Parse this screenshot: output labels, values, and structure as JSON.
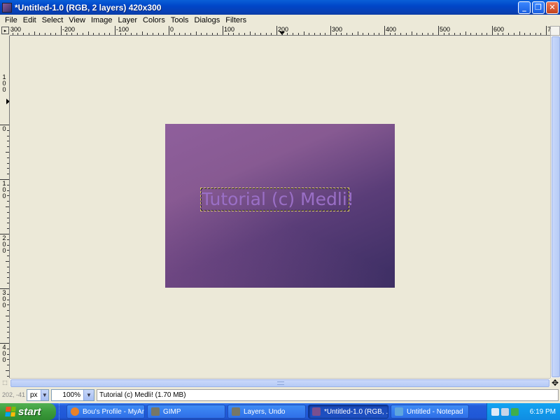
{
  "window": {
    "title": "*Untitled-1.0 (RGB, 2 layers) 420x300",
    "minimize": "_",
    "maximize": "❐",
    "close": "✕"
  },
  "menu": [
    "File",
    "Edit",
    "Select",
    "View",
    "Image",
    "Layer",
    "Colors",
    "Tools",
    "Dialogs",
    "Filters"
  ],
  "hruler_labels": [
    "-300",
    "-200",
    "-100",
    "0",
    "100",
    "200",
    "300",
    "400",
    "500",
    "600",
    "700",
    "800"
  ],
  "vruler_labels": [
    "0",
    "100",
    "200",
    "300",
    "400"
  ],
  "vruler_top_label": "1\n0\n0",
  "canvas": {
    "text_layer": "Tutorial (c) Medli!"
  },
  "status": {
    "coords": "202, -41",
    "unit": "px",
    "zoom": "100%",
    "message": "Tutorial (c) Medli! (1.70 MB)"
  },
  "taskbar": {
    "start": "start",
    "tasks": [
      {
        "label": "Bou's Profile - MyAni...",
        "icon_color": "#e8822a"
      },
      {
        "label": "GIMP",
        "icon_color": "#777766"
      },
      {
        "label": "Layers, Undo",
        "icon_color": "#777766"
      },
      {
        "label": "*Untitled-1.0 (RGB, ...",
        "icon_color": "#7a4f8f"
      },
      {
        "label": "Untitled - Notepad",
        "icon_color": "#5fa6dd"
      }
    ],
    "clock": "6:19 PM"
  },
  "colors": {
    "titlebar": "#0046c8",
    "taskbar": "#245edb",
    "start": "#3c9b3c",
    "image_start": "#8f5f9c",
    "image_end": "#3a2d62",
    "text_color": "#9a6fc6"
  }
}
